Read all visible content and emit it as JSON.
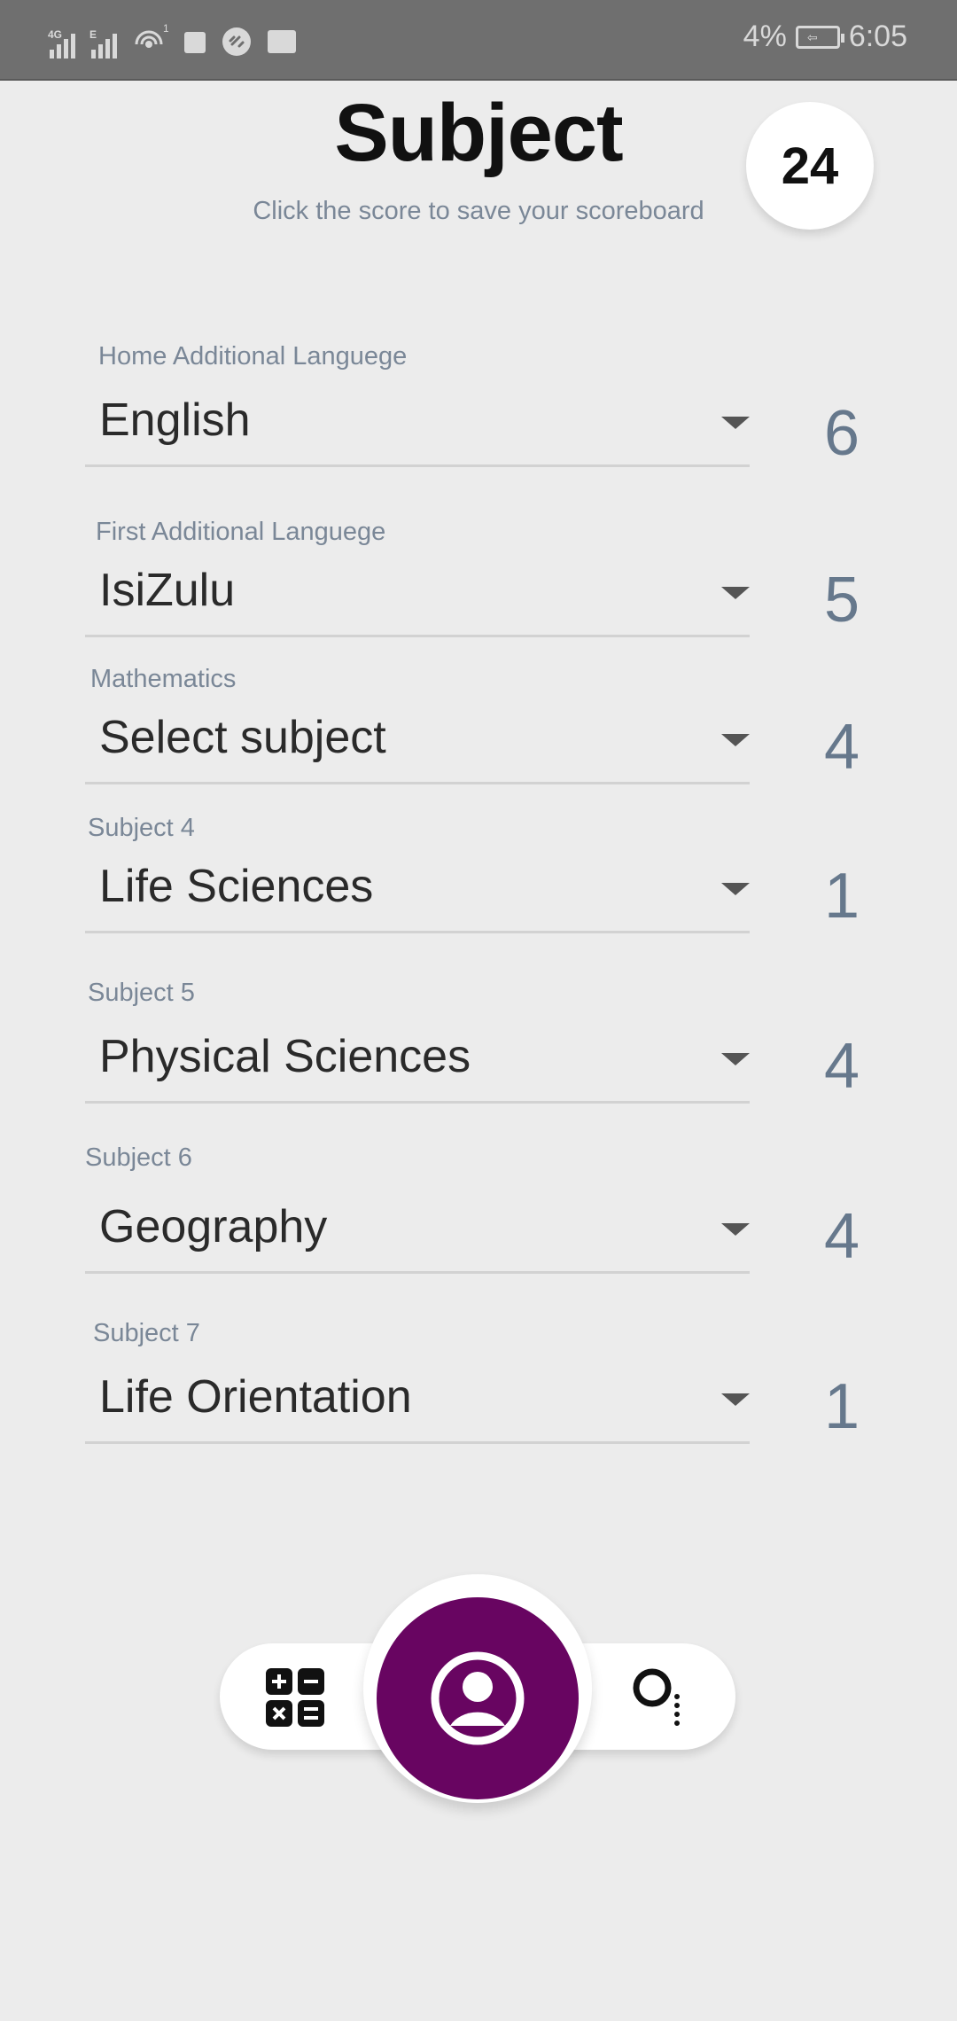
{
  "status_bar": {
    "network_1": "4G",
    "network_2": "E",
    "hotspot_count": "1",
    "battery_percent": "4%",
    "time": "6:05"
  },
  "header": {
    "title": "Subject",
    "subtitle": "Click the score to save your scoreboard",
    "total_score": "24"
  },
  "subjects": [
    {
      "label": "Home Additional Languege",
      "value": "English",
      "score": "6"
    },
    {
      "label": "First Additional Languege",
      "value": "IsiZulu",
      "score": "5"
    },
    {
      "label": "Mathematics",
      "value": "Select subject",
      "score": "4"
    },
    {
      "label": "Subject 4",
      "value": "Life Sciences",
      "score": "1"
    },
    {
      "label": "Subject 5",
      "value": "Physical Sciences",
      "score": "4"
    },
    {
      "label": "Subject 6",
      "value": "Geography",
      "score": "4"
    },
    {
      "label": "Subject 7",
      "value": "Life Orientation",
      "score": "1"
    }
  ],
  "bottom_nav": {
    "left_icon": "calculator-icon",
    "center_icon": "profile-icon",
    "right_icon": "search-icon",
    "accent_color": "#680561"
  }
}
